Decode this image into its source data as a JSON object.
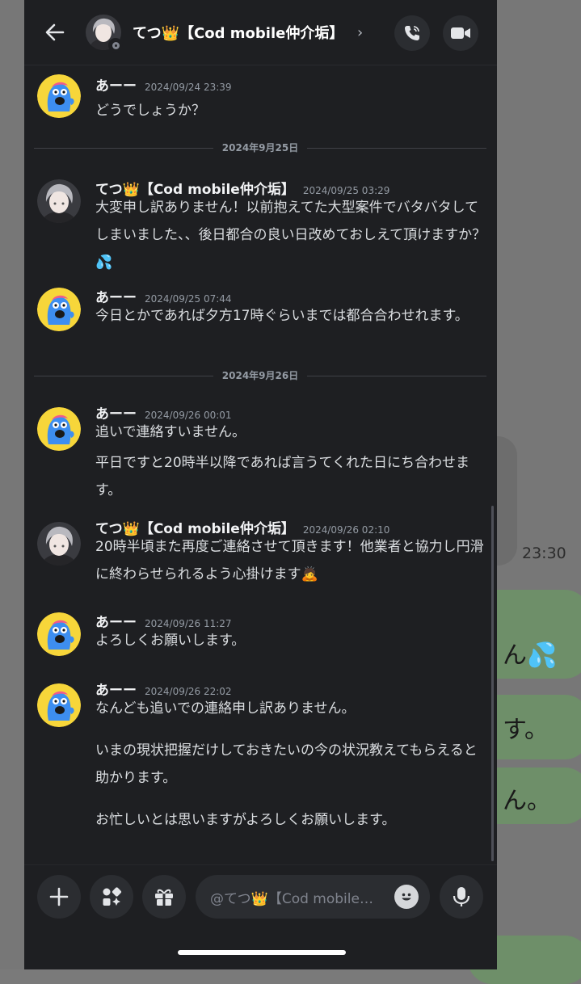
{
  "header": {
    "title": "てつ👑【Cod mobile仲介垢】",
    "chevron": "›"
  },
  "dividers": [
    {
      "label": "2024年9月25日"
    },
    {
      "label": "2024年9月26日"
    }
  ],
  "messages": [
    {
      "author": "あーー",
      "timestamp": "2024/09/24 23:39",
      "lines": [
        "どうでしょうか？"
      ]
    },
    {
      "author": "てつ👑【Cod mobile仲介垢】",
      "timestamp": "2024/09/25 03:29",
      "lines": [
        "大変申し訳ありません！以前抱えてた大型案件でバタバタしてしまいました、、後日都合の良い日改めておしえて頂けますか？💦"
      ]
    },
    {
      "author": "あーー",
      "timestamp": "2024/09/25 07:44",
      "lines": [
        "今日とかであれば夕方17時ぐらいまでは都合合わせれます。"
      ]
    },
    {
      "author": "あーー",
      "timestamp": "2024/09/26 00:01",
      "lines": [
        "追いで連絡すいません。",
        "平日ですと20時半以降であれば言うてくれた日にち合わせます。"
      ]
    },
    {
      "author": "てつ👑【Cod mobile仲介垢】",
      "timestamp": "2024/09/26 02:10",
      "lines": [
        "20時半頃また再度ご連絡させて頂きます！他業者と協力し円滑に終わらせられるよう心掛けます🙇"
      ]
    },
    {
      "author": "あーー",
      "timestamp": "2024/09/26 11:27",
      "lines": [
        "よろしくお願いします。"
      ]
    },
    {
      "author": "あーー",
      "timestamp": "2024/09/26 22:02",
      "lines": [
        "なんども追いでの連絡申し訳ありません。",
        "",
        "いまの現状把握だけしておきたいの今の状況教えてもらえると助かります。",
        "",
        "お忙しいとは思いますがよろしくお願いします。"
      ]
    }
  ],
  "input": {
    "placeholder": "@てつ👑【Cod mobile…"
  },
  "background": {
    "time": "23:30",
    "fragments": [
      "ん💦",
      "す。",
      "ん。"
    ]
  },
  "colors": {
    "panel": "#1e1f22",
    "button": "#2b2d31",
    "text": "#dbdee1",
    "muted": "#949ba4"
  }
}
